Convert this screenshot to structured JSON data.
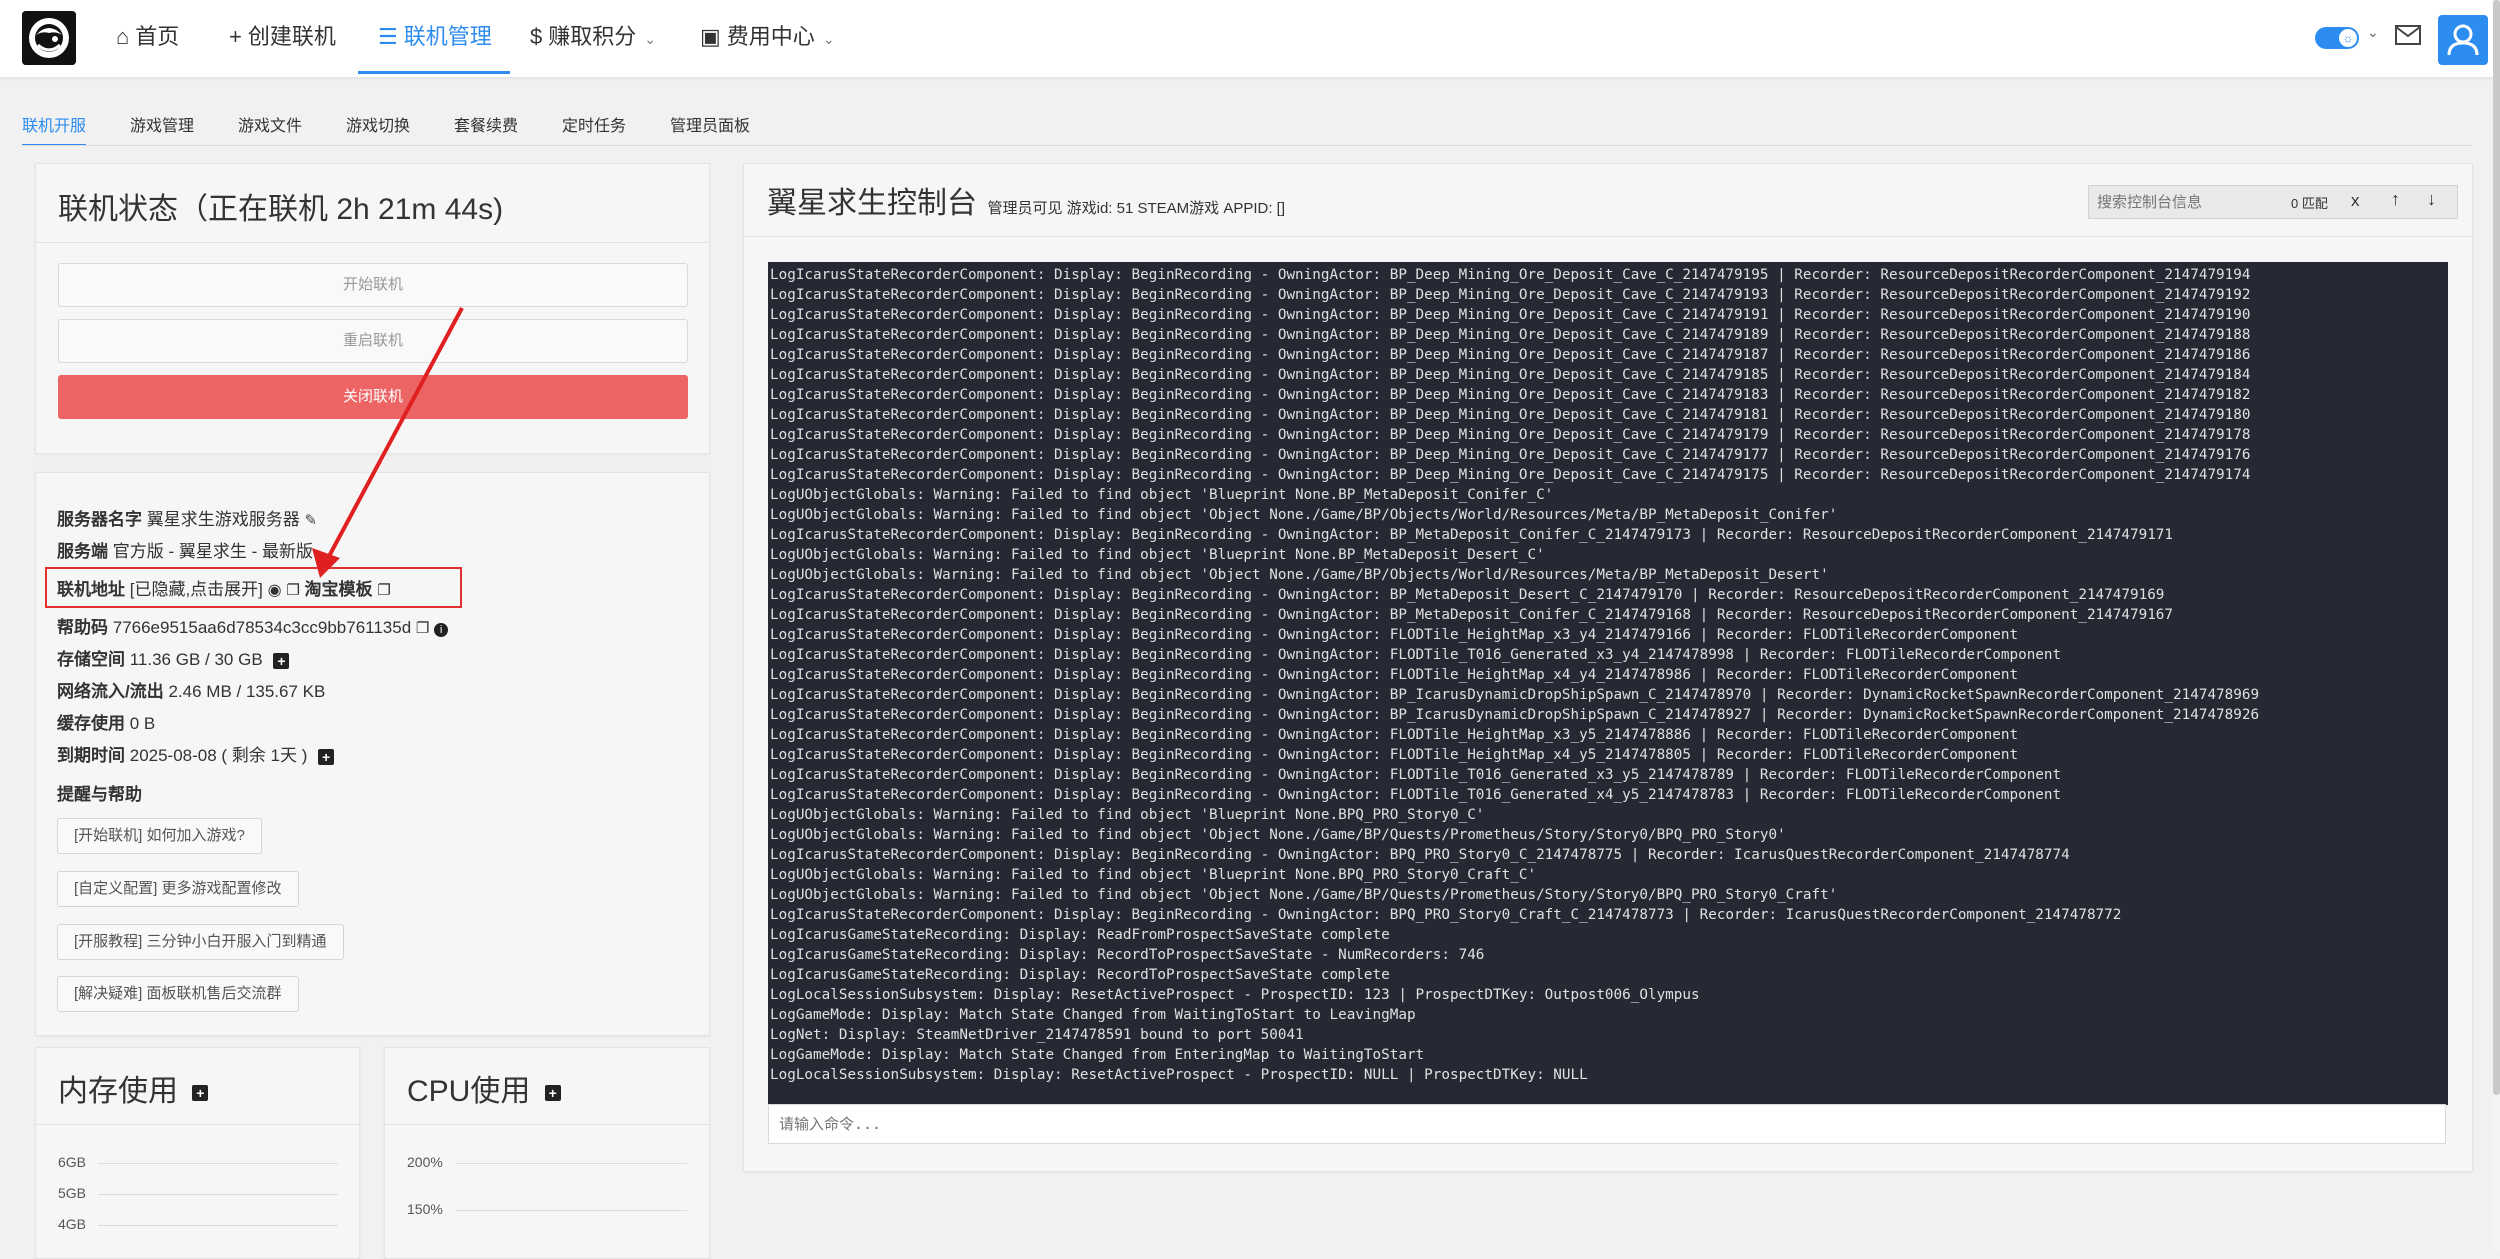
{
  "nav": {
    "items": [
      {
        "icon": "home-icon",
        "glyph": "⌂",
        "label": "首页"
      },
      {
        "icon": "plus-icon",
        "glyph": "+",
        "label": "创建联机"
      },
      {
        "icon": "server-icon",
        "glyph": "☰",
        "label": "联机管理"
      },
      {
        "icon": "dollar-icon",
        "glyph": "$",
        "label": "赚取积分"
      },
      {
        "icon": "bag-icon",
        "glyph": "▣",
        "label": "费用中心"
      }
    ],
    "active": "联机管理",
    "accent": "#2d8cf0"
  },
  "subtabs": [
    "联机开服",
    "游戏管理",
    "游戏文件",
    "游戏切换",
    "套餐续费",
    "定时任务",
    "管理员面板"
  ],
  "status_card": {
    "title": "联机状态（正在联机 2h 21m 44s)",
    "start_label": "开始联机",
    "restart_label": "重启联机",
    "close_label": "关闭联机"
  },
  "server_info": {
    "name_label": "服务器名字",
    "name_value": "翼星求生游戏服务器",
    "edition_label": "服务端",
    "edition_value": "官方版 - 翼星求生 - 最新版",
    "address_label": "联机地址",
    "address_value": "[已隐藏,点击展开]",
    "template_label": "淘宝模板",
    "help_code_label": "帮助码",
    "help_code_value": "7766e9515aa6d78534c3cc9bb761135d",
    "storage_label": "存储空间",
    "storage_value": "11.36 GB / 30 GB",
    "net_label": "网络流入/流出",
    "net_value": "2.46 MB / 135.67 KB",
    "cache_label": "缓存使用",
    "cache_value": "0 B",
    "expire_label": "到期时间",
    "expire_value": "2025-08-08 ( 剩余 1天 )",
    "tips_title": "提醒与帮助",
    "help_buttons": [
      "[开始联机] 如何加入游戏?",
      "[自定义配置] 更多游戏配置修改",
      "[开服教程] 三分钟小白开服入门到精通",
      "[解决疑难] 面板联机售后交流群"
    ]
  },
  "memory_card": {
    "title": "内存使用",
    "ticks": [
      "6GB",
      "5GB",
      "4GB"
    ]
  },
  "cpu_card": {
    "title": "CPU使用",
    "ticks": [
      "200%",
      "150%"
    ]
  },
  "console": {
    "title": "翼星求生控制台",
    "subtitle": "管理员可见 游戏id: 51 STEAM游戏 APPID: []",
    "search_placeholder": "搜索控制台信息",
    "match_count": "0 匹配",
    "clear_label": "x",
    "up_label": "↑",
    "down_label": "↓",
    "input_placeholder": "请输入命令...",
    "lines": [
      "LogIcarusStateRecorderComponent: Display: BeginRecording - OwningActor: BP_Deep_Mining_Ore_Deposit_Cave_C_2147479195 | Recorder: ResourceDepositRecorderComponent_2147479194",
      "LogIcarusStateRecorderComponent: Display: BeginRecording - OwningActor: BP_Deep_Mining_Ore_Deposit_Cave_C_2147479193 | Recorder: ResourceDepositRecorderComponent_2147479192",
      "LogIcarusStateRecorderComponent: Display: BeginRecording - OwningActor: BP_Deep_Mining_Ore_Deposit_Cave_C_2147479191 | Recorder: ResourceDepositRecorderComponent_2147479190",
      "LogIcarusStateRecorderComponent: Display: BeginRecording - OwningActor: BP_Deep_Mining_Ore_Deposit_Cave_C_2147479189 | Recorder: ResourceDepositRecorderComponent_2147479188",
      "LogIcarusStateRecorderComponent: Display: BeginRecording - OwningActor: BP_Deep_Mining_Ore_Deposit_Cave_C_2147479187 | Recorder: ResourceDepositRecorderComponent_2147479186",
      "LogIcarusStateRecorderComponent: Display: BeginRecording - OwningActor: BP_Deep_Mining_Ore_Deposit_Cave_C_2147479185 | Recorder: ResourceDepositRecorderComponent_2147479184",
      "LogIcarusStateRecorderComponent: Display: BeginRecording - OwningActor: BP_Deep_Mining_Ore_Deposit_Cave_C_2147479183 | Recorder: ResourceDepositRecorderComponent_2147479182",
      "LogIcarusStateRecorderComponent: Display: BeginRecording - OwningActor: BP_Deep_Mining_Ore_Deposit_Cave_C_2147479181 | Recorder: ResourceDepositRecorderComponent_2147479180",
      "LogIcarusStateRecorderComponent: Display: BeginRecording - OwningActor: BP_Deep_Mining_Ore_Deposit_Cave_C_2147479179 | Recorder: ResourceDepositRecorderComponent_2147479178",
      "LogIcarusStateRecorderComponent: Display: BeginRecording - OwningActor: BP_Deep_Mining_Ore_Deposit_Cave_C_2147479177 | Recorder: ResourceDepositRecorderComponent_2147479176",
      "LogIcarusStateRecorderComponent: Display: BeginRecording - OwningActor: BP_Deep_Mining_Ore_Deposit_Cave_C_2147479175 | Recorder: ResourceDepositRecorderComponent_2147479174",
      "LogUObjectGlobals: Warning: Failed to find object 'Blueprint None.BP_MetaDeposit_Conifer_C'",
      "LogUObjectGlobals: Warning: Failed to find object 'Object None./Game/BP/Objects/World/Resources/Meta/BP_MetaDeposit_Conifer'",
      "LogIcarusStateRecorderComponent: Display: BeginRecording - OwningActor: BP_MetaDeposit_Conifer_C_2147479173 | Recorder: ResourceDepositRecorderComponent_2147479171",
      "LogUObjectGlobals: Warning: Failed to find object 'Blueprint None.BP_MetaDeposit_Desert_C'",
      "LogUObjectGlobals: Warning: Failed to find object 'Object None./Game/BP/Objects/World/Resources/Meta/BP_MetaDeposit_Desert'",
      "LogIcarusStateRecorderComponent: Display: BeginRecording - OwningActor: BP_MetaDeposit_Desert_C_2147479170 | Recorder: ResourceDepositRecorderComponent_2147479169",
      "LogIcarusStateRecorderComponent: Display: BeginRecording - OwningActor: BP_MetaDeposit_Conifer_C_2147479168 | Recorder: ResourceDepositRecorderComponent_2147479167",
      "LogIcarusStateRecorderComponent: Display: BeginRecording - OwningActor: FLODTile_HeightMap_x3_y4_2147479166 | Recorder: FLODTileRecorderComponent",
      "LogIcarusStateRecorderComponent: Display: BeginRecording - OwningActor: FLODTile_T016_Generated_x3_y4_2147478998 | Recorder: FLODTileRecorderComponent",
      "LogIcarusStateRecorderComponent: Display: BeginRecording - OwningActor: FLODTile_HeightMap_x4_y4_2147478986 | Recorder: FLODTileRecorderComponent",
      "LogIcarusStateRecorderComponent: Display: BeginRecording - OwningActor: BP_IcarusDynamicDropShipSpawn_C_2147478970 | Recorder: DynamicRocketSpawnRecorderComponent_2147478969",
      "LogIcarusStateRecorderComponent: Display: BeginRecording - OwningActor: BP_IcarusDynamicDropShipSpawn_C_2147478927 | Recorder: DynamicRocketSpawnRecorderComponent_2147478926",
      "LogIcarusStateRecorderComponent: Display: BeginRecording - OwningActor: FLODTile_HeightMap_x3_y5_2147478886 | Recorder: FLODTileRecorderComponent",
      "LogIcarusStateRecorderComponent: Display: BeginRecording - OwningActor: FLODTile_HeightMap_x4_y5_2147478805 | Recorder: FLODTileRecorderComponent",
      "LogIcarusStateRecorderComponent: Display: BeginRecording - OwningActor: FLODTile_T016_Generated_x3_y5_2147478789 | Recorder: FLODTileRecorderComponent",
      "LogIcarusStateRecorderComponent: Display: BeginRecording - OwningActor: FLODTile_T016_Generated_x4_y5_2147478783 | Recorder: FLODTileRecorderComponent",
      "LogUObjectGlobals: Warning: Failed to find object 'Blueprint None.BPQ_PRO_Story0_C'",
      "LogUObjectGlobals: Warning: Failed to find object 'Object None./Game/BP/Quests/Prometheus/Story/Story0/BPQ_PRO_Story0'",
      "LogIcarusStateRecorderComponent: Display: BeginRecording - OwningActor: BPQ_PRO_Story0_C_2147478775 | Recorder: IcarusQuestRecorderComponent_2147478774",
      "LogUObjectGlobals: Warning: Failed to find object 'Blueprint None.BPQ_PRO_Story0_Craft_C'",
      "LogUObjectGlobals: Warning: Failed to find object 'Object None./Game/BP/Quests/Prometheus/Story/Story0/BPQ_PRO_Story0_Craft'",
      "LogIcarusStateRecorderComponent: Display: BeginRecording - OwningActor: BPQ_PRO_Story0_Craft_C_2147478773 | Recorder: IcarusQuestRecorderComponent_2147478772",
      "LogIcarusGameStateRecording: Display: ReadFromProspectSaveState complete",
      "LogIcarusGameStateRecording: Display: RecordToProspectSaveState - NumRecorders: 746",
      "LogIcarusGameStateRecording: Display: RecordToProspectSaveState complete",
      "LogLocalSessionSubsystem: Display: ResetActiveProspect - ProspectID: 123 | ProspectDTKey: Outpost006_Olympus",
      "LogGameMode: Display: Match State Changed from WaitingToStart to LeavingMap",
      "LogNet: Display: SteamNetDriver_2147478591 bound to port 50041",
      "LogGameMode: Display: Match State Changed from EnteringMap to WaitingToStart",
      "LogLocalSessionSubsystem: Display: ResetActiveProspect - ProspectID: NULL | ProspectDTKey: NULL"
    ]
  }
}
